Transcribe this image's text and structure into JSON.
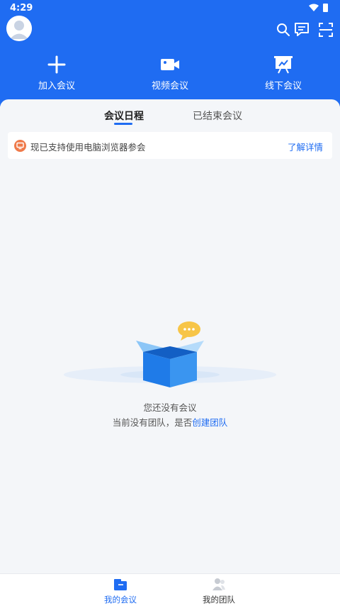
{
  "status_bar": {
    "time": "4:29"
  },
  "header": {
    "actions": [
      {
        "label": "加入会议",
        "icon": "plus-icon"
      },
      {
        "label": "视频会议",
        "icon": "video-camera-icon"
      },
      {
        "label": "线下会议",
        "icon": "presentation-board-icon"
      }
    ],
    "top_icons": [
      "search-icon",
      "message-icon",
      "scan-icon"
    ]
  },
  "tabs": {
    "schedule": "会议日程",
    "ended": "已结束会议"
  },
  "notice": {
    "text": "现已支持使用电脑浏览器参会",
    "link": "了解详情"
  },
  "empty_state": {
    "title": "您还没有会议",
    "subtitle": "当前没有团队，是否",
    "link": "创建团队"
  },
  "bottom_nav": {
    "my_meetings": "我的会议",
    "my_team": "我的团队"
  },
  "colors": {
    "brand": "#1f6cf2",
    "notice_icon": "#ef7a4a"
  }
}
